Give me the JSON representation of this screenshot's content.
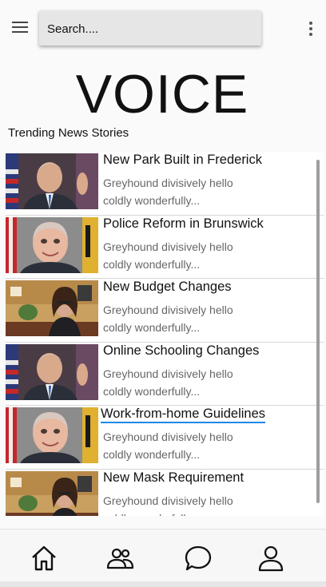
{
  "header": {
    "search_placeholder": "Search....",
    "menu_icon": "hamburger-menu-icon",
    "more_icon": "more-vertical-icon"
  },
  "brand": {
    "title": "VOICE"
  },
  "section": {
    "title": "Trending News Stories"
  },
  "news": [
    {
      "title": "New Park Built in Frederick",
      "snippet": "Greyhound divisively hello coldly wonderfully...",
      "thumb": "man-with-flag-photo"
    },
    {
      "title": "Police Reform in Brunswick",
      "snippet": "Greyhound divisively hello coldly wonderfully...",
      "thumb": "bald-man-photo"
    },
    {
      "title": "New Budget Changes",
      "snippet": "Greyhound divisively hello coldly wonderfully...",
      "thumb": "woman-office-photo"
    },
    {
      "title": "Online Schooling Changes",
      "snippet": "Greyhound divisively hello coldly wonderfully...",
      "thumb": "man-with-flag-photo"
    },
    {
      "title": "Work-from-home Guidelines",
      "snippet": "Greyhound divisively hello coldly wonderfully...",
      "thumb": "bald-man-photo"
    },
    {
      "title": "New Mask Requirement",
      "snippet": "Greyhound divisively hello coldly wonderfully...",
      "thumb": "woman-office-photo"
    }
  ],
  "bottom_nav": [
    {
      "name": "home-icon"
    },
    {
      "name": "people-icon"
    },
    {
      "name": "chat-icon"
    },
    {
      "name": "profile-icon"
    }
  ],
  "colors": {
    "link_underline": "#1e88e5",
    "snippet": "#666666"
  }
}
